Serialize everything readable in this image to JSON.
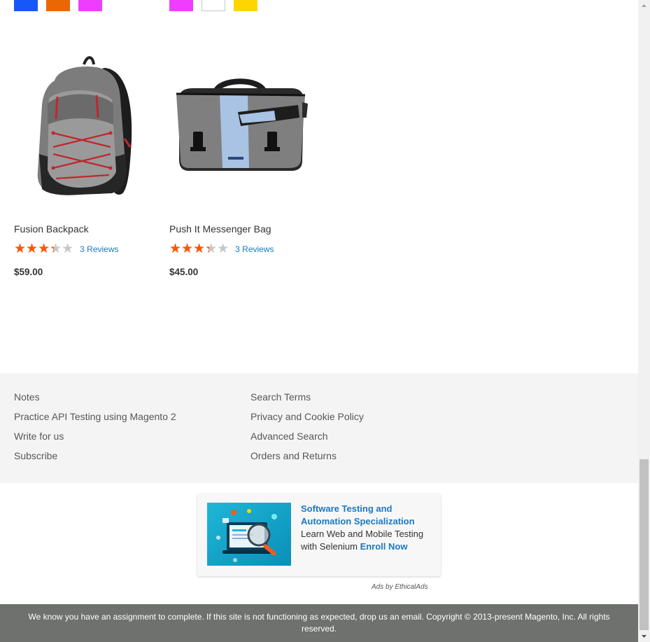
{
  "swatches": [
    {
      "group": "backpack",
      "color": "#1857f7"
    },
    {
      "group": "backpack",
      "color": "#eb6703"
    },
    {
      "group": "backpack",
      "color": "#ef3dff"
    },
    {
      "group": "messenger",
      "color": "#ef3dff"
    },
    {
      "group": "messenger",
      "color": "#ffffff"
    },
    {
      "group": "messenger",
      "color": "#ffd500"
    }
  ],
  "products": [
    {
      "name": "Fusion Backpack",
      "rating_percent": 67,
      "reviews": "3 Reviews",
      "price": "$59.00",
      "image_icon": "backpack-image"
    },
    {
      "name": "Push It Messenger Bag",
      "rating_percent": 67,
      "reviews": "3 Reviews",
      "price": "$45.00",
      "image_icon": "messenger-bag-image"
    }
  ],
  "footer": {
    "col1": [
      "Notes",
      "Practice API Testing using Magento 2",
      "Write for us",
      "Subscribe"
    ],
    "col2": [
      "Search Terms",
      "Privacy and Cookie Policy",
      "Advanced Search",
      "Orders and Returns"
    ]
  },
  "ad": {
    "title": "Software Testing and Automation Specialization",
    "body": "Learn Web and Mobile Testing with Selenium",
    "cta": "Enroll Now",
    "by": "Ads by EthicalAds",
    "accent": "#1979c3"
  },
  "copyright": "We know you have an assignment to complete. If this site is not functioning as expected, drop us an email. Copyright © 2013-present Magento, Inc. All rights reserved.",
  "colors": {
    "star_fill": "#ff5501",
    "star_empty": "#c7c7c7",
    "link": "#1979c3",
    "footer_bg": "#f4f4f4",
    "copyright_bg": "#6e716e"
  }
}
